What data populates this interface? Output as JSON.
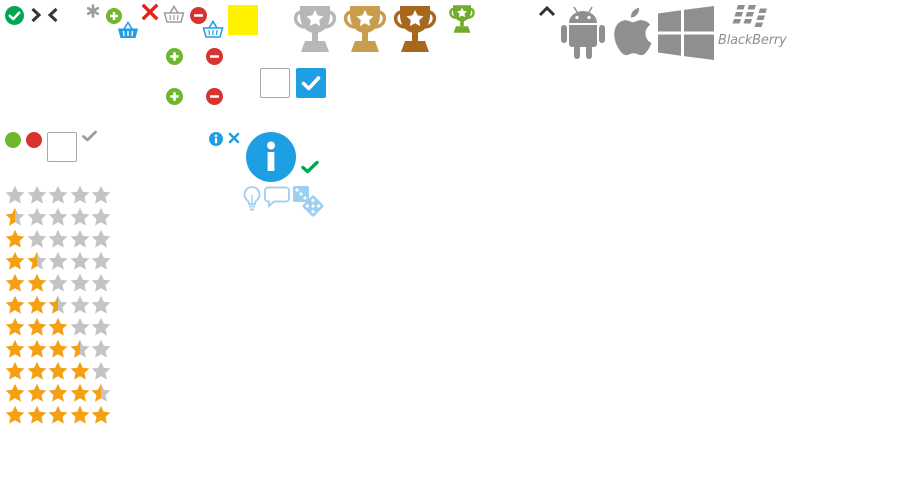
{
  "colors": {
    "green": "#00a651",
    "lime": "#6fb72c",
    "red": "#d9322f",
    "crossRed": "#e2231a",
    "blue": "#1e9fe3",
    "lightBlue": "#9bd0f0",
    "grey": "#9c9c9c",
    "darkGrey": "#333333",
    "yellow": "#fff200",
    "starOn": "#f4a015",
    "starOff": "#c4c4c4",
    "trophySilver": "#b7b7b7",
    "trophyGold": "#c99d4e",
    "trophyBronze": "#a7671d",
    "trophyGreen": "#71ac2b",
    "osGrey": "#8f8f8f"
  },
  "icons": {
    "row1": [
      "check-circle-icon",
      "chevron-right-icon",
      "chevron-left-icon",
      "asterisk-icon",
      "add-circle-icon",
      "basket-add-icon",
      "close-x-icon",
      "basket-icon",
      "remove-circle-icon",
      "basket-remove-icon",
      "yellow-square-swatch"
    ],
    "trophies": [
      "silver-trophy-icon",
      "gold-trophy-icon",
      "bronze-trophy-icon",
      "green-trophy-icon"
    ],
    "os": [
      "chevron-up-icon",
      "android-icon",
      "apple-icon",
      "windows-icon",
      "blackberry-icon"
    ],
    "misc": [
      "info-icon",
      "close-icon",
      "lightbulb-icon",
      "speech-bubble-icon",
      "dice-icon"
    ]
  },
  "os": {
    "blackberry_label": "BlackBerry"
  },
  "checkboxes": {
    "unchecked": false,
    "checked": true,
    "small_unchecked": false
  },
  "ratings": {
    "max": 5,
    "values": [
      0,
      0.5,
      1,
      1.5,
      2,
      2.5,
      3,
      3.5,
      4,
      4.5,
      5
    ]
  }
}
